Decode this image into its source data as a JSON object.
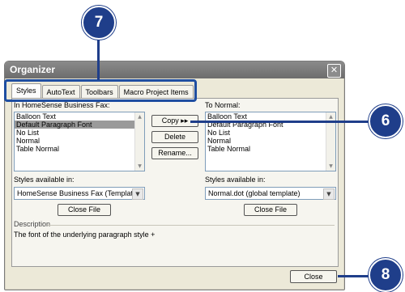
{
  "window": {
    "title": "Organizer",
    "close_glyph": "✕"
  },
  "tabs": [
    {
      "label": "Styles",
      "active": true
    },
    {
      "label": "AutoText",
      "active": false
    },
    {
      "label": "Toolbars",
      "active": false
    },
    {
      "label": "Macro Project Items",
      "active": false
    }
  ],
  "left": {
    "heading": "In HomeSense Business Fax:",
    "items": [
      "Balloon Text",
      "Default Paragraph Font",
      "No List",
      "Normal",
      "Table Normal"
    ],
    "selected_index": 1,
    "available_label": "Styles available in:",
    "available_value": "HomeSense Business Fax (Template)",
    "close_file": "Close File"
  },
  "right": {
    "heading": "To Normal:",
    "items": [
      "Balloon Text",
      "Default Paragraph Font",
      "No List",
      "Normal",
      "Table Normal"
    ],
    "available_label": "Styles available in:",
    "available_value": "Normal.dot (global template)",
    "close_file": "Close File"
  },
  "actions": {
    "copy": "Copy ▸▸",
    "delete": "Delete",
    "rename": "Rename..."
  },
  "description": {
    "label": "Description",
    "text": "The font of the underlying paragraph style +"
  },
  "footer": {
    "close": "Close"
  },
  "callouts": {
    "tabs": "7",
    "copy": "6",
    "close": "8"
  },
  "colors": {
    "callout": "#1f3e8a",
    "selection": "#9a9a9a"
  }
}
